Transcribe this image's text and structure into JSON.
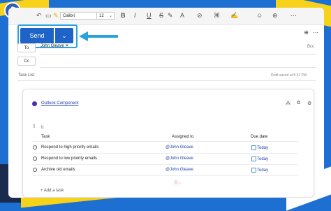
{
  "toolbar": {
    "font_name": "Calibri",
    "font_size": "12",
    "bold": "B",
    "italic": "I",
    "underline": "U",
    "strike": "S"
  },
  "compose": {
    "send_label": "Send",
    "to_label": "To",
    "cc_label": "Cc",
    "bcc_label": "Bcc",
    "recipient": "John Gleave",
    "subject": "Task List",
    "draft_status": "Draft saved at 5:32 PM"
  },
  "component": {
    "title": "Outlook Component",
    "columns": [
      "Task",
      "Assigned to",
      "Due date"
    ],
    "tasks": [
      {
        "task": "Respond to high priority emails",
        "assignee": "@John Gleave",
        "due": "Today"
      },
      {
        "task": "Respond to low priority emails",
        "assignee": "@John Gleave",
        "due": "Today"
      },
      {
        "task": "Archive old emails",
        "assignee": "@John Gleave",
        "due": "Today"
      }
    ],
    "add_task_label": "Add a task"
  },
  "colors": {
    "accent": "#1e63c7",
    "highlight": "#29a3e0",
    "link": "#1e3fa8"
  }
}
